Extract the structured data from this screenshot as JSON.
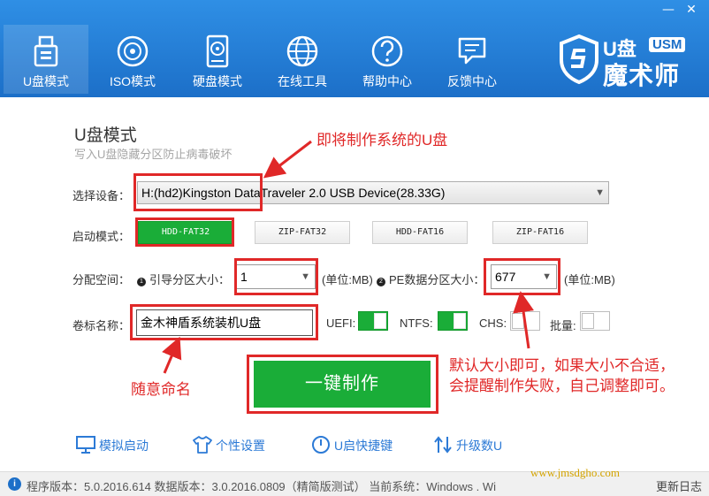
{
  "window": {
    "minimize": "—",
    "close": "✕"
  },
  "nav": [
    {
      "label": "U盘模式",
      "icon": "usb-drive-icon",
      "active": true
    },
    {
      "label": "ISO模式",
      "icon": "disc-icon",
      "active": false
    },
    {
      "label": "硬盘模式",
      "icon": "hard-disk-icon",
      "active": false
    },
    {
      "label": "在线工具",
      "icon": "globe-icon",
      "active": false
    },
    {
      "label": "帮助中心",
      "icon": "help-icon",
      "active": false
    },
    {
      "label": "反馈中心",
      "icon": "feedback-icon",
      "active": false
    }
  ],
  "brand": {
    "usm": "USM",
    "name": "魔术师",
    "u": "U盘"
  },
  "main": {
    "title": "U盘模式",
    "subtitle": "写入U盘隐藏分区防止病毒破坏",
    "device_label": "选择设备：",
    "device_value": "H:(hd2)Kingston DataTraveler 2.0 USB Device(28.33G)",
    "boot_label": "启动模式：",
    "boot_modes": [
      "HDD-FAT32",
      "ZIP-FAT32",
      "HDD-FAT16",
      "ZIP-FAT16"
    ],
    "partition_label": "分配空间：",
    "boot_size_label": "引导分区大小：",
    "boot_size_value": "1",
    "unit1": "(单位:MB)",
    "pe_size_label": "PE数据分区大小：",
    "pe_size_value": "677",
    "unit2": "(单位:MB)",
    "volume_label": "卷标名称：",
    "volume_value": "金木神盾系统装机U盘",
    "uefi_label": "UEFI:",
    "ntfs_label": "NTFS:",
    "chs_label": "CHS:",
    "batch_label": "批量:",
    "make_button": "一键制作"
  },
  "annotations": {
    "device": "即将制作系统的U盘",
    "name": "随意命名",
    "size_line1": "默认大小即可，如果大小不合适，",
    "size_line2": "会提醒制作失败，自己调整即可。"
  },
  "bottom_links": [
    {
      "label": "模拟启动",
      "icon": "monitor-icon"
    },
    {
      "label": "个性设置",
      "icon": "shirt-icon"
    },
    {
      "label": "U启快捷键",
      "icon": "power-icon"
    },
    {
      "label": "升级数U",
      "icon": "upgrade-icon"
    }
  ],
  "status": {
    "text": "程序版本：5.0.2016.614   数据版本：3.0.2016.0809（精简版测试）  当前系统：Windows . Wi",
    "update": "更新日志",
    "watermark": "www.jmsdgho.com"
  },
  "colors": {
    "header": "#1c6fc8",
    "green": "#1aad38",
    "red": "#e02828",
    "link": "#2c7ad6"
  }
}
